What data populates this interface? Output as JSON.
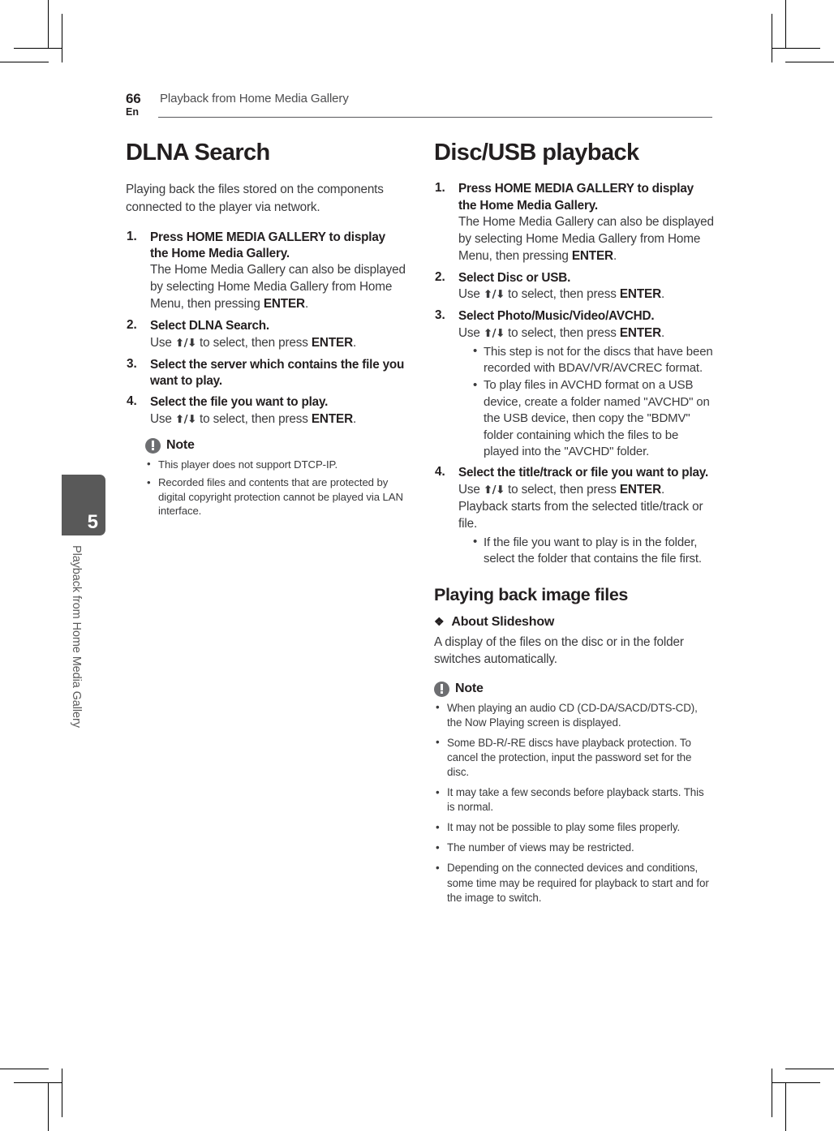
{
  "header": {
    "page_number": "66",
    "language": "En",
    "title": "Playback from Home Media Gallery"
  },
  "side_tab": {
    "chapter_number": "5",
    "chapter_label": "Playback from Home Media Gallery",
    "color": "#595959"
  },
  "left_column": {
    "section_title": "DLNA Search",
    "intro": "Playing back the files stored on the components connected to the player via network.",
    "steps": [
      {
        "head_prefix": "Press ",
        "head_bold": "HOME MEDIA GALLERY",
        "head_suffix": " to display the Home Media Gallery.",
        "body_prefix": "The Home Media Gallery can also be displayed by selecting Home Media Gallery from Home Menu, then pressing ",
        "body_bold": "ENTER",
        "body_suffix": "."
      },
      {
        "head": "Select DLNA Search.",
        "body_prefix": "Use ",
        "arrows": "⬆/⬇",
        "body_mid": " to select, then press ",
        "body_bold": "ENTER",
        "body_suffix": "."
      },
      {
        "head": "Select the server which contains the file you want to play."
      },
      {
        "head": "Select the file you want to play.",
        "body_prefix": "Use ",
        "arrows": "⬆/⬇",
        "body_mid": " to select, then press ",
        "body_bold": "ENTER",
        "body_suffix": "."
      }
    ],
    "note": {
      "title": "Note",
      "icon": "exclamation-circle-icon",
      "items": [
        "This player does not support DTCP-IP.",
        "Recorded files and contents that are protected by digital copyright protection cannot be played via LAN interface."
      ]
    }
  },
  "right_column": {
    "section_title": "Disc/USB playback",
    "steps": [
      {
        "head_prefix": "Press ",
        "head_bold": "HOME MEDIA GALLERY",
        "head_suffix": " to display the Home Media Gallery.",
        "body_prefix": "The Home Media Gallery can also be displayed by selecting Home Media Gallery from Home Menu, then pressing ",
        "body_bold": "ENTER",
        "body_suffix": "."
      },
      {
        "head": "Select Disc or USB.",
        "body_prefix": "Use ",
        "arrows": "⬆/⬇",
        "body_mid": " to select, then press ",
        "body_bold": "ENTER",
        "body_suffix": "."
      },
      {
        "head": "Select Photo/Music/Video/AVCHD.",
        "body_prefix": "Use ",
        "arrows": "⬆/⬇",
        "body_mid": " to select, then press ",
        "body_bold": "ENTER",
        "body_suffix": ".",
        "bullets": [
          "This step is not for the discs that have been recorded with BDAV/VR/AVCREC format.",
          "To play files in AVCHD format on a USB device, create a folder named \"AVCHD\" on the USB device, then copy the \"BDMV\" folder containing which the files to be played into the \"AVCHD\" folder."
        ]
      },
      {
        "head": "Select the title/track or file you want to play.",
        "body_prefix": "Use ",
        "arrows": "⬆/⬇",
        "body_mid": " to select, then press ",
        "body_bold": "ENTER",
        "body_suffix": ". Playback starts from the selected title/track or file.",
        "bullets": [
          "If the file you want to play is in the folder, select the folder that contains the file first."
        ]
      }
    ],
    "sub_section_title": "Playing back image files",
    "diamond_glyph": "❖",
    "diamond_heading": "About Slideshow",
    "diamond_body": "A display of the files on the disc or in the folder switches automatically.",
    "note": {
      "title": "Note",
      "icon": "exclamation-circle-icon",
      "items": [
        "When playing an audio CD (CD-DA/SACD/DTS-CD), the Now Playing screen is displayed.",
        "Some BD-R/-RE discs have playback protection. To cancel the protection, input the password set for the disc.",
        "It may take a few seconds before playback starts. This is normal.",
        "It may not be possible to play some files properly.",
        "The number of views may be restricted.",
        "Depending on the connected devices and conditions, some time may be required for playback to start and for the image to switch."
      ]
    }
  }
}
